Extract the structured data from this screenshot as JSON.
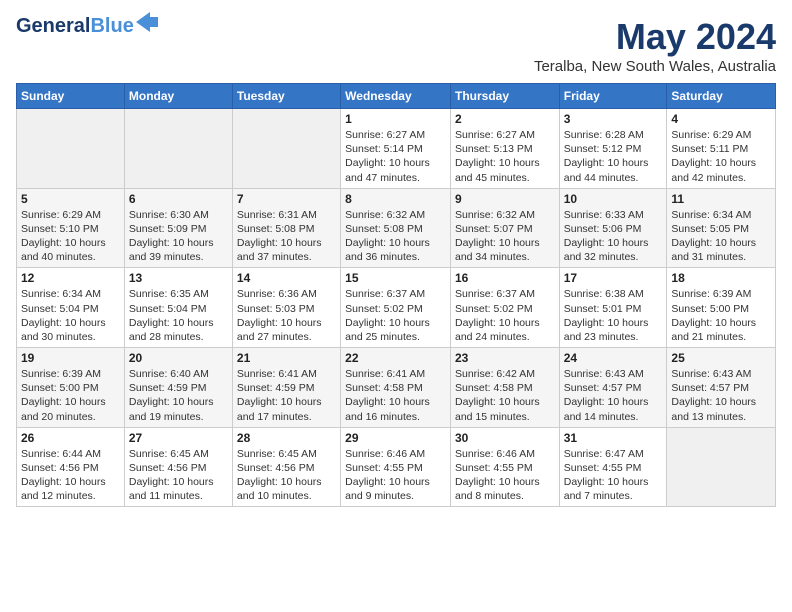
{
  "logo": {
    "line1": "General",
    "line2": "Blue"
  },
  "title": "May 2024",
  "subtitle": "Teralba, New South Wales, Australia",
  "weekdays": [
    "Sunday",
    "Monday",
    "Tuesday",
    "Wednesday",
    "Thursday",
    "Friday",
    "Saturday"
  ],
  "weeks": [
    [
      {
        "day": "",
        "info": ""
      },
      {
        "day": "",
        "info": ""
      },
      {
        "day": "",
        "info": ""
      },
      {
        "day": "1",
        "info": "Sunrise: 6:27 AM\nSunset: 5:14 PM\nDaylight: 10 hours\nand 47 minutes."
      },
      {
        "day": "2",
        "info": "Sunrise: 6:27 AM\nSunset: 5:13 PM\nDaylight: 10 hours\nand 45 minutes."
      },
      {
        "day": "3",
        "info": "Sunrise: 6:28 AM\nSunset: 5:12 PM\nDaylight: 10 hours\nand 44 minutes."
      },
      {
        "day": "4",
        "info": "Sunrise: 6:29 AM\nSunset: 5:11 PM\nDaylight: 10 hours\nand 42 minutes."
      }
    ],
    [
      {
        "day": "5",
        "info": "Sunrise: 6:29 AM\nSunset: 5:10 PM\nDaylight: 10 hours\nand 40 minutes."
      },
      {
        "day": "6",
        "info": "Sunrise: 6:30 AM\nSunset: 5:09 PM\nDaylight: 10 hours\nand 39 minutes."
      },
      {
        "day": "7",
        "info": "Sunrise: 6:31 AM\nSunset: 5:08 PM\nDaylight: 10 hours\nand 37 minutes."
      },
      {
        "day": "8",
        "info": "Sunrise: 6:32 AM\nSunset: 5:08 PM\nDaylight: 10 hours\nand 36 minutes."
      },
      {
        "day": "9",
        "info": "Sunrise: 6:32 AM\nSunset: 5:07 PM\nDaylight: 10 hours\nand 34 minutes."
      },
      {
        "day": "10",
        "info": "Sunrise: 6:33 AM\nSunset: 5:06 PM\nDaylight: 10 hours\nand 32 minutes."
      },
      {
        "day": "11",
        "info": "Sunrise: 6:34 AM\nSunset: 5:05 PM\nDaylight: 10 hours\nand 31 minutes."
      }
    ],
    [
      {
        "day": "12",
        "info": "Sunrise: 6:34 AM\nSunset: 5:04 PM\nDaylight: 10 hours\nand 30 minutes."
      },
      {
        "day": "13",
        "info": "Sunrise: 6:35 AM\nSunset: 5:04 PM\nDaylight: 10 hours\nand 28 minutes."
      },
      {
        "day": "14",
        "info": "Sunrise: 6:36 AM\nSunset: 5:03 PM\nDaylight: 10 hours\nand 27 minutes."
      },
      {
        "day": "15",
        "info": "Sunrise: 6:37 AM\nSunset: 5:02 PM\nDaylight: 10 hours\nand 25 minutes."
      },
      {
        "day": "16",
        "info": "Sunrise: 6:37 AM\nSunset: 5:02 PM\nDaylight: 10 hours\nand 24 minutes."
      },
      {
        "day": "17",
        "info": "Sunrise: 6:38 AM\nSunset: 5:01 PM\nDaylight: 10 hours\nand 23 minutes."
      },
      {
        "day": "18",
        "info": "Sunrise: 6:39 AM\nSunset: 5:00 PM\nDaylight: 10 hours\nand 21 minutes."
      }
    ],
    [
      {
        "day": "19",
        "info": "Sunrise: 6:39 AM\nSunset: 5:00 PM\nDaylight: 10 hours\nand 20 minutes."
      },
      {
        "day": "20",
        "info": "Sunrise: 6:40 AM\nSunset: 4:59 PM\nDaylight: 10 hours\nand 19 minutes."
      },
      {
        "day": "21",
        "info": "Sunrise: 6:41 AM\nSunset: 4:59 PM\nDaylight: 10 hours\nand 17 minutes."
      },
      {
        "day": "22",
        "info": "Sunrise: 6:41 AM\nSunset: 4:58 PM\nDaylight: 10 hours\nand 16 minutes."
      },
      {
        "day": "23",
        "info": "Sunrise: 6:42 AM\nSunset: 4:58 PM\nDaylight: 10 hours\nand 15 minutes."
      },
      {
        "day": "24",
        "info": "Sunrise: 6:43 AM\nSunset: 4:57 PM\nDaylight: 10 hours\nand 14 minutes."
      },
      {
        "day": "25",
        "info": "Sunrise: 6:43 AM\nSunset: 4:57 PM\nDaylight: 10 hours\nand 13 minutes."
      }
    ],
    [
      {
        "day": "26",
        "info": "Sunrise: 6:44 AM\nSunset: 4:56 PM\nDaylight: 10 hours\nand 12 minutes."
      },
      {
        "day": "27",
        "info": "Sunrise: 6:45 AM\nSunset: 4:56 PM\nDaylight: 10 hours\nand 11 minutes."
      },
      {
        "day": "28",
        "info": "Sunrise: 6:45 AM\nSunset: 4:56 PM\nDaylight: 10 hours\nand 10 minutes."
      },
      {
        "day": "29",
        "info": "Sunrise: 6:46 AM\nSunset: 4:55 PM\nDaylight: 10 hours\nand 9 minutes."
      },
      {
        "day": "30",
        "info": "Sunrise: 6:46 AM\nSunset: 4:55 PM\nDaylight: 10 hours\nand 8 minutes."
      },
      {
        "day": "31",
        "info": "Sunrise: 6:47 AM\nSunset: 4:55 PM\nDaylight: 10 hours\nand 7 minutes."
      },
      {
        "day": "",
        "info": ""
      }
    ]
  ]
}
